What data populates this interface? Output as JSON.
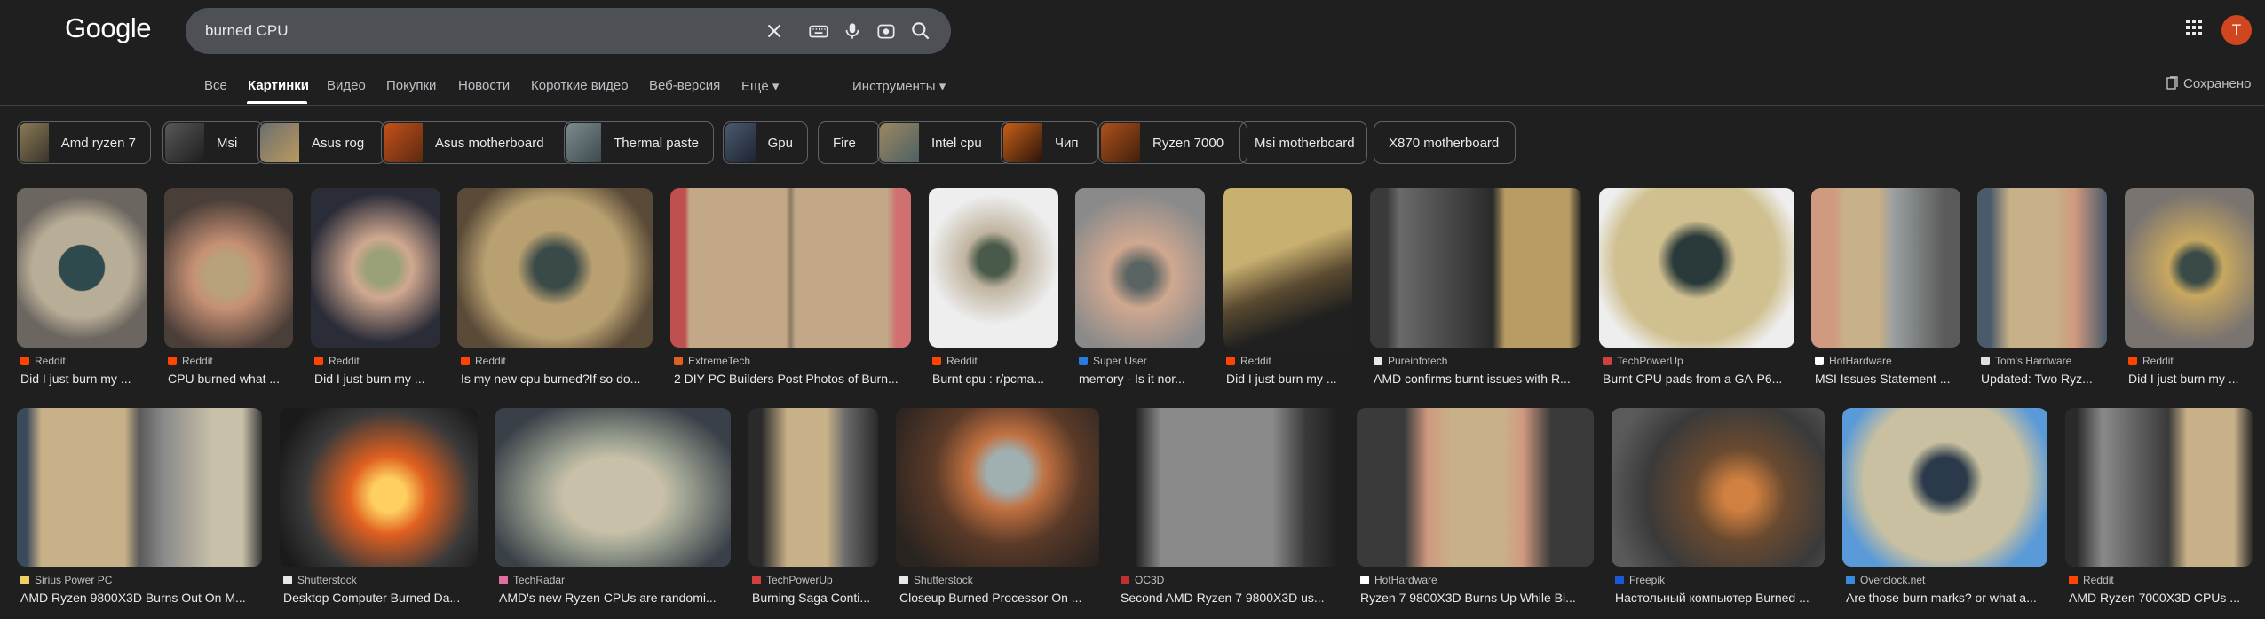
{
  "logo": "Google",
  "search": {
    "query": "burned CPU"
  },
  "header": {
    "avatar_letter": "T"
  },
  "tabs": [
    {
      "label": "Все"
    },
    {
      "label": "Картинки"
    },
    {
      "label": "Видео"
    },
    {
      "label": "Покупки"
    },
    {
      "label": "Новости"
    },
    {
      "label": "Короткие видео"
    },
    {
      "label": "Веб-версия"
    },
    {
      "label": "Ещё ▾"
    }
  ],
  "tools_label": "Инструменты ▾",
  "saved_label": "Сохранено",
  "chips": [
    {
      "label": "Amd ryzen 7"
    },
    {
      "label": "Msi"
    },
    {
      "label": "Asus rog"
    },
    {
      "label": "Asus motherboard"
    },
    {
      "label": "Thermal paste"
    },
    {
      "label": "Gpu"
    },
    {
      "label": "Fire"
    },
    {
      "label": "Intel cpu"
    },
    {
      "label": "Чип"
    },
    {
      "label": "Ryzen 7000"
    },
    {
      "label": "Msi motherboard"
    },
    {
      "label": "X870 motherboard"
    }
  ],
  "results_row1": [
    {
      "source": "Reddit",
      "title": "Did I just burn my ..."
    },
    {
      "source": "Reddit",
      "title": "CPU burned what ..."
    },
    {
      "source": "Reddit",
      "title": "Did I just burn my ..."
    },
    {
      "source": "Reddit",
      "title": "Is my new cpu burned?If so do..."
    },
    {
      "source": "ExtremeTech",
      "title": "2 DIY PC Builders Post Photos of Burn..."
    },
    {
      "source": "Reddit",
      "title": "Burnt cpu : r/pcma..."
    },
    {
      "source": "Super User",
      "title": "memory - Is it nor..."
    },
    {
      "source": "Reddit",
      "title": "Did I just burn my ..."
    },
    {
      "source": "Pureinfotech",
      "title": "AMD confirms burnt issues with R..."
    },
    {
      "source": "TechPowerUp",
      "title": "Burnt CPU pads from a GA-P6..."
    },
    {
      "source": "HotHardware",
      "title": "MSI Issues Statement ..."
    },
    {
      "source": "Tom's Hardware",
      "title": "Updated: Two Ryz..."
    },
    {
      "source": "Reddit",
      "title": "Did I just burn my ..."
    }
  ],
  "results_row2": [
    {
      "source": "Sirius Power PC",
      "title": "AMD Ryzen 9800X3D Burns Out On M..."
    },
    {
      "source": "Shutterstock",
      "title": "Desktop Computer Burned Da..."
    },
    {
      "source": "TechRadar",
      "title": "AMD's new Ryzen CPUs are randomi..."
    },
    {
      "source": "TechPowerUp",
      "title": "Burning Saga Conti..."
    },
    {
      "source": "Shutterstock",
      "title": "Closeup Burned Processor On ..."
    },
    {
      "source": "OC3D",
      "title": "Second AMD Ryzen 7 9800X3D us..."
    },
    {
      "source": "HotHardware",
      "title": "Ryzen 7 9800X3D Burns Up While Bi..."
    },
    {
      "source": "Freepik",
      "title": "Настольный компьютер Burned ..."
    },
    {
      "source": "Overclock.net",
      "title": "Are those burn marks? or what a..."
    },
    {
      "source": "Reddit",
      "title": "AMD Ryzen 7000X3D CPUs ..."
    }
  ]
}
